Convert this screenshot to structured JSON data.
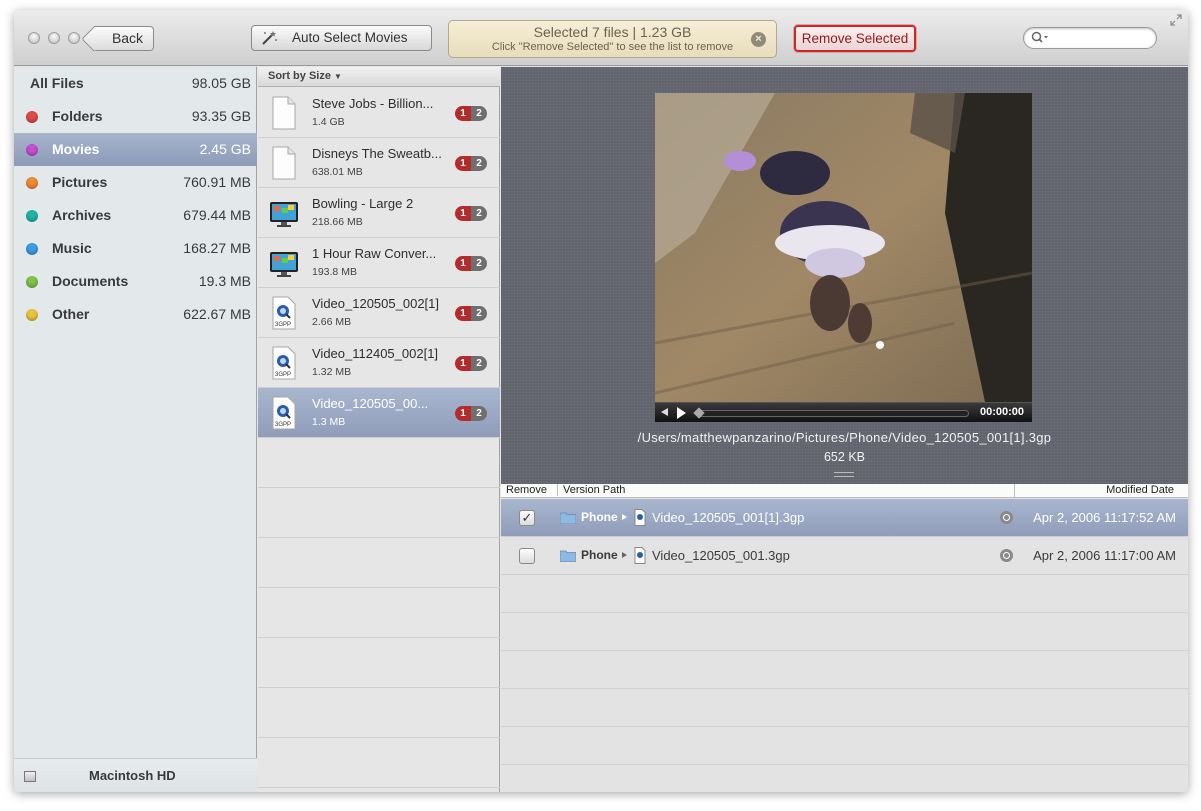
{
  "toolbar": {
    "back_label": "Back",
    "auto_select_label": "Auto Select Movies",
    "status_line1": "Selected 7 files | 1.23 GB",
    "status_line2": "Click \"Remove Selected\" to see the list to remove",
    "remove_selected_label": "Remove Selected",
    "search_placeholder": ""
  },
  "sidebar": {
    "items": [
      {
        "label": "All Files",
        "size": "98.05 GB"
      },
      {
        "label": "Folders",
        "size": "93.35 GB",
        "color": "#e04a4a"
      },
      {
        "label": "Movies",
        "size": "2.45 GB",
        "color": "#c24fd0"
      },
      {
        "label": "Pictures",
        "size": "760.91 MB",
        "color": "#ef8a35"
      },
      {
        "label": "Archives",
        "size": "679.44 MB",
        "color": "#1fb5a6"
      },
      {
        "label": "Music",
        "size": "168.27 MB",
        "color": "#3d9be0"
      },
      {
        "label": "Documents",
        "size": "19.3 MB",
        "color": "#7fc24a"
      },
      {
        "label": "Other",
        "size": "622.67 MB",
        "color": "#e8c53a"
      }
    ],
    "selected_index": 2,
    "disk_label": "Macintosh HD"
  },
  "filelist": {
    "sort_label": "Sort by Size",
    "files": [
      {
        "name": "Steve Jobs - Billion...",
        "size": "1.4 GB",
        "icon": "document-icon",
        "badge_a": "1",
        "badge_b": "2"
      },
      {
        "name": "Disneys The Sweatb...",
        "size": "638.01 MB",
        "icon": "document-icon",
        "badge_a": "1",
        "badge_b": "2"
      },
      {
        "name": "Bowling - Large 2",
        "size": "218.66 MB",
        "icon": "movie-monitor-icon",
        "badge_a": "1",
        "badge_b": "2"
      },
      {
        "name": "1 Hour Raw Conver...",
        "size": "193.8 MB",
        "icon": "movie-monitor-icon",
        "badge_a": "1",
        "badge_b": "2"
      },
      {
        "name": "Video_120505_002[1]",
        "size": "2.66 MB",
        "icon": "3gpp-file-icon",
        "badge_a": "1",
        "badge_b": "2"
      },
      {
        "name": "Video_112405_002[1]",
        "size": "1.32 MB",
        "icon": "3gpp-file-icon",
        "badge_a": "1",
        "badge_b": "2"
      },
      {
        "name": "Video_120505_00...",
        "size": "1.3 MB",
        "icon": "3gpp-file-icon",
        "badge_a": "1",
        "badge_b": "2"
      }
    ],
    "selected_index": 6
  },
  "preview": {
    "time": "00:00:00",
    "path": "/Users/matthewpanzarino/Pictures/Phone/Video_120505_001[1].3gp",
    "size": "652 KB"
  },
  "versions": {
    "header_remove": "Remove",
    "header_path": "Version Path",
    "header_date": "Modified Date",
    "rows": [
      {
        "checked": "✓",
        "folder": "Phone",
        "file": "Video_120505_001[1].3gp",
        "date": "Apr 2, 2006 11:17:52 AM"
      },
      {
        "checked": "",
        "folder": "Phone",
        "file": "Video_120505_001.3gp",
        "date": "Apr 2, 2006 11:17:00 AM"
      }
    ],
    "selected_index": 0
  }
}
